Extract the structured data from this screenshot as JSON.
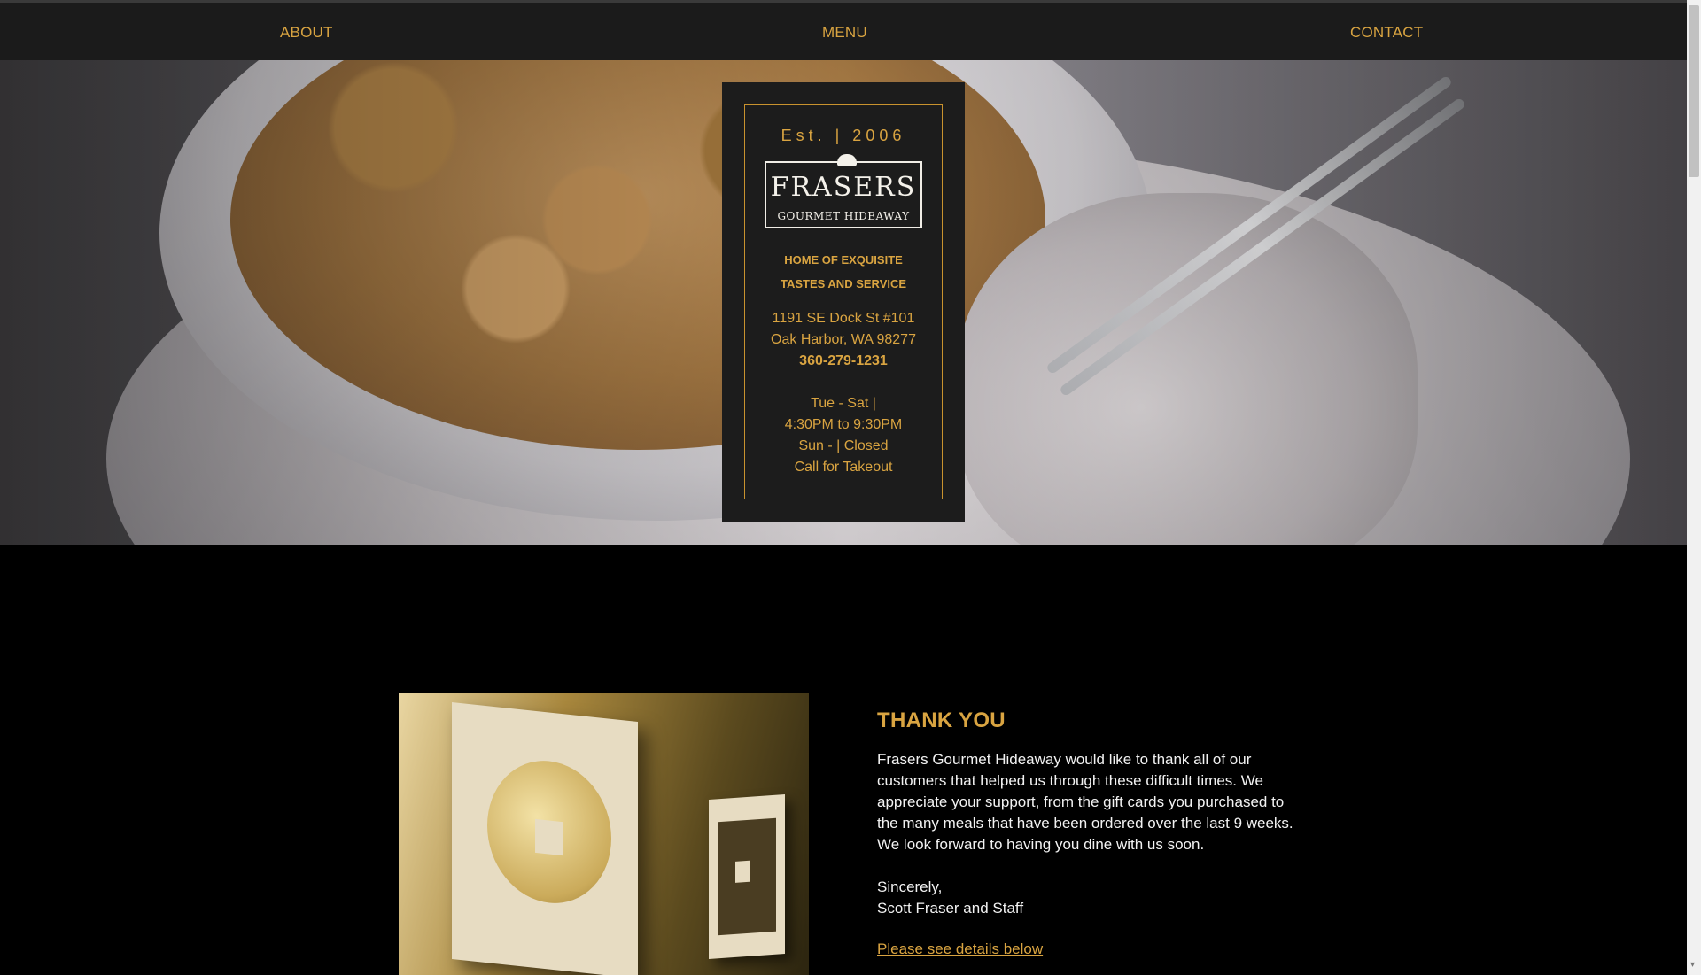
{
  "nav": {
    "about": "ABOUT",
    "menu": "MENU",
    "contact": "CONTACT"
  },
  "card": {
    "established": "Est. | 2006",
    "logo_name": "FRASERS",
    "logo_sub": "GOURMET HIDEAWAY",
    "tagline_1": "HOME OF EXQUISITE",
    "tagline_2": "TASTES AND SERVICE",
    "address_1": "1191 SE Dock St #101",
    "address_2": "Oak Harbor, WA 98277",
    "phone": "360-279-1231",
    "hours_1": "Tue - Sat |",
    "hours_2": "4:30PM to 9:30PM",
    "hours_3": "Sun - | Closed",
    "hours_4": "Call for Takeout"
  },
  "thank_you": {
    "title": "THANK YOU",
    "body": "Frasers Gourmet Hideaway would like to thank all of our customers that helped us through these difficult times. We appreciate your support, from the gift cards you purchased to the many meals that have been ordered over the last 9 weeks. We look forward to having you dine with us soon.",
    "sign_1": "Sincerely,",
    "sign_2": "Scott Fraser and Staff",
    "details_link": "Please see details below"
  },
  "colors": {
    "accent": "#d9a441",
    "nav_bg": "#1b1b1b",
    "page_bg": "#000000",
    "card_bg": "#1c1c1c"
  },
  "icons": {
    "scroll_down": "chevron-down-icon",
    "logo_hat": "chef-hat-icon"
  }
}
